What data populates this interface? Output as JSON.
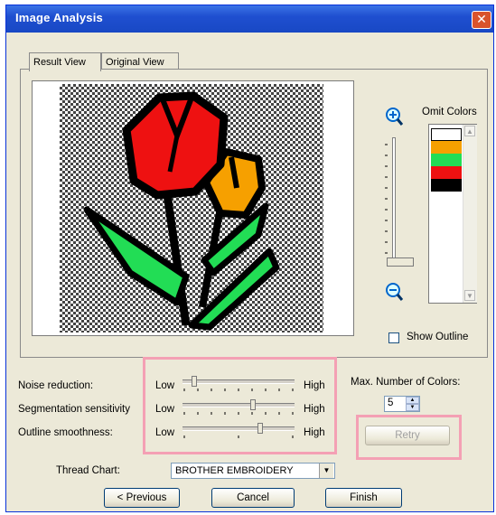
{
  "window": {
    "title": "Image Analysis",
    "close_glyph": "✕"
  },
  "tabs": [
    {
      "label": "Result View",
      "active": true
    },
    {
      "label": "Original View",
      "active": false
    }
  ],
  "omit_colors": {
    "label": "Omit Colors",
    "swatches": [
      "#ffffff",
      "#f6a000",
      "#22dd55",
      "#ee1111",
      "#000000"
    ]
  },
  "show_outline": {
    "label": "Show Outline",
    "checked": false
  },
  "sliders": [
    {
      "label": "Noise reduction:",
      "low": "Low",
      "high": "High",
      "level": 0.08
    },
    {
      "label": "Segmentation sensitivity",
      "low": "Low",
      "high": "High",
      "level": 0.62
    },
    {
      "label": "Outline smoothness:",
      "low": "Low",
      "high": "High",
      "level": 0.68
    }
  ],
  "max_colors": {
    "label": "Max. Number of Colors:",
    "value": "5"
  },
  "retry_button": "Retry",
  "thread_chart": {
    "label": "Thread Chart:",
    "value": "BROTHER EMBROIDERY"
  },
  "buttons": {
    "previous": "< Previous",
    "cancel": "Cancel",
    "finish": "Finish"
  },
  "colors": {
    "title_bar": "#1f4fd0",
    "highlight": "#f4a0b4",
    "dialog_bg": "#ece9d8"
  },
  "icons": [
    "zoom-in-icon",
    "zoom-out-icon",
    "close-icon",
    "dropdown-arrow-icon",
    "spin-up-icon",
    "spin-down-icon"
  ]
}
